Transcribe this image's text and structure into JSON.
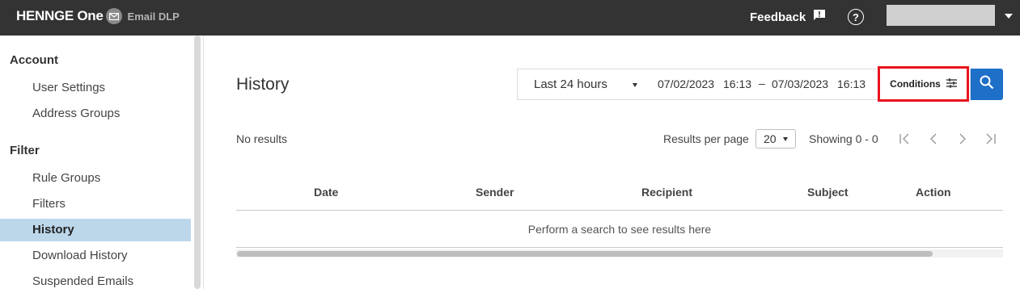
{
  "topbar": {
    "brand": "HENNGE One",
    "product": "Email DLP",
    "feedback_label": "Feedback",
    "help_glyph": "?",
    "user_caret_icon": "caret-down-icon"
  },
  "sidebar": {
    "sections": [
      {
        "title": "Account",
        "items": [
          "User Settings",
          "Address Groups"
        ]
      },
      {
        "title": "Filter",
        "items": [
          "Rule Groups",
          "Filters",
          "History",
          "Download History",
          "Suspended Emails"
        ]
      }
    ],
    "active_item": "History",
    "active_color": "#bcd7ea"
  },
  "main": {
    "title": "History",
    "search": {
      "range": "Last 24 hours",
      "from_date": "07/02/2023",
      "from_time": "16:13",
      "separator": "–",
      "to_date": "07/03/2023",
      "to_time": "16:13",
      "conditions_label": "Conditions",
      "conditions_icon": "sliders-icon",
      "search_icon": "search-icon",
      "search_button_color": "#1e6fc8",
      "highlight_color": "#e8141e"
    },
    "results_summary": "No results",
    "results_per_page_label": "Results per page",
    "results_per_page": "20",
    "showing": "Showing 0 - 0",
    "pagination_icons": [
      "first-page-icon",
      "prev-page-icon",
      "next-page-icon",
      "last-page-icon"
    ],
    "table": {
      "columns": [
        "Date",
        "Sender",
        "Recipient",
        "Subject",
        "Action"
      ],
      "empty_message": "Perform a search to see results here"
    }
  }
}
